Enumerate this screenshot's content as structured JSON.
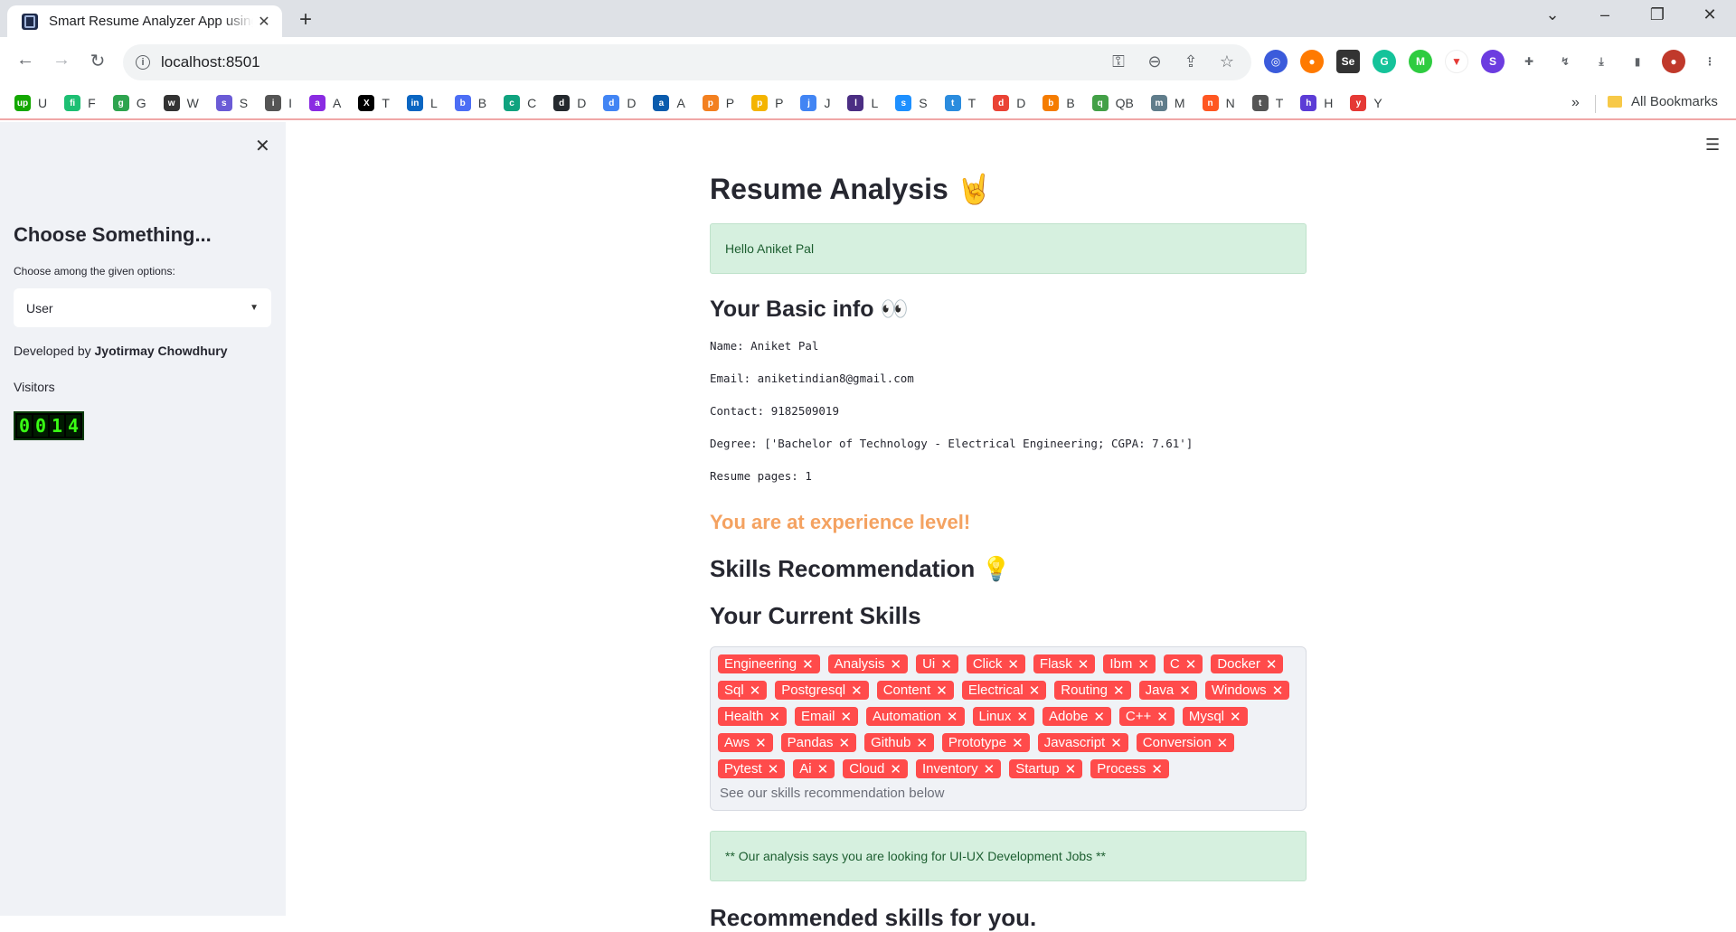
{
  "browser": {
    "tab_title": "Smart Resume Analyzer App using",
    "url": "localhost:8501",
    "bookmarks": [
      {
        "label": "U",
        "color": "#14a800",
        "glyph": "up"
      },
      {
        "label": "F",
        "color": "#1dbf73",
        "glyph": "fi"
      },
      {
        "label": "G",
        "color": "#2ea44f",
        "glyph": "g"
      },
      {
        "label": "W",
        "color": "#333333",
        "glyph": "w"
      },
      {
        "label": "S",
        "color": "#6b5bd6",
        "glyph": "s"
      },
      {
        "label": "I",
        "color": "#555555",
        "glyph": "i"
      },
      {
        "label": "A",
        "color": "#8a2be2",
        "glyph": "a"
      },
      {
        "label": "T",
        "color": "#000000",
        "glyph": "X"
      },
      {
        "label": "L",
        "color": "#0a66c2",
        "glyph": "in"
      },
      {
        "label": "B",
        "color": "#4c6ef5",
        "glyph": "b"
      },
      {
        "label": "C",
        "color": "#10a37f",
        "glyph": "c"
      },
      {
        "label": "D",
        "color": "#24292e",
        "glyph": "d"
      },
      {
        "label": "D",
        "color": "#4285f4",
        "glyph": "d"
      },
      {
        "label": "A",
        "color": "#0b5cad",
        "glyph": "a"
      },
      {
        "label": "P",
        "color": "#f38020",
        "glyph": "p"
      },
      {
        "label": "P",
        "color": "#f4b400",
        "glyph": "p"
      },
      {
        "label": "J",
        "color": "#4285f4",
        "glyph": "j"
      },
      {
        "label": "L",
        "color": "#4b2e83",
        "glyph": "l"
      },
      {
        "label": "S",
        "color": "#1e90ff",
        "glyph": "s"
      },
      {
        "label": "T",
        "color": "#2b8cde",
        "glyph": "t"
      },
      {
        "label": "D",
        "color": "#ea4335",
        "glyph": "d"
      },
      {
        "label": "B",
        "color": "#f57c00",
        "glyph": "b"
      },
      {
        "label": "QB",
        "color": "#43a047",
        "glyph": "q"
      },
      {
        "label": "M",
        "color": "#607d8b",
        "glyph": "m"
      },
      {
        "label": "N",
        "color": "#ff5722",
        "glyph": "n"
      },
      {
        "label": "T",
        "color": "#555555",
        "glyph": "t"
      },
      {
        "label": "H",
        "color": "#5c3cd6",
        "glyph": "h"
      },
      {
        "label": "Y",
        "color": "#e53935",
        "glyph": "y"
      }
    ],
    "all_bookmarks": "All Bookmarks"
  },
  "sidebar": {
    "title": "Choose Something...",
    "select_label": "Choose among the given options:",
    "select_value": "User",
    "developed_prefix": "Developed by ",
    "developer": "Jyotirmay Chowdhury",
    "visitors_label": "Visitors",
    "visitor_digits": [
      "0",
      "0",
      "1",
      "4"
    ]
  },
  "main": {
    "title": "Resume Analysis 🤘",
    "greeting": "Hello Aniket Pal",
    "basic_info_heading": "Your Basic info 👀",
    "name_line": "Name: Aniket Pal",
    "email_line": "Email: aniketindian8@gmail.com",
    "contact_line": "Contact: 9182509019",
    "degree_line": "Degree: ['Bachelor of Technology - Electrical Engineering; CGPA: 7.61']",
    "pages_line": "Resume pages: 1",
    "experience_text": "You are at experience level!",
    "skills_rec_heading": "Skills Recommendation 💡",
    "current_skills_heading": "Your Current Skills",
    "skills": [
      "Engineering",
      "Analysis",
      "Ui",
      "Click",
      "Flask",
      "Ibm",
      "C",
      "Docker",
      "Sql",
      "Postgresql",
      "Content",
      "Electrical",
      "Routing",
      "Java",
      "Windows",
      "Health",
      "Email",
      "Automation",
      "Linux",
      "Adobe",
      "C++",
      "Mysql",
      "Aws",
      "Pandas",
      "Github",
      "Prototype",
      "Javascript",
      "Conversion",
      "Pytest",
      "Ai",
      "Cloud",
      "Inventory",
      "Startup",
      "Process"
    ],
    "skills_placeholder": "See our skills recommendation below",
    "analysis_note": "** Our analysis says you are looking for UI-UX Development Jobs **",
    "recommended_heading": "Recommended skills for you."
  },
  "colors": {
    "tag_bg": "#ff4b4b",
    "success_bg": "#d6f0df",
    "experience": "#f4a261",
    "sidebar_bg": "#f0f2f6"
  }
}
